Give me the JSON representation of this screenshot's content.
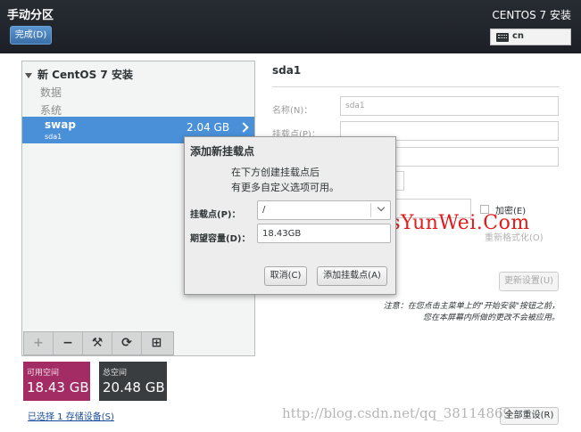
{
  "header": {
    "title": "手动分区",
    "done_label": "完成(D)",
    "product": "CENTOS 7 安装",
    "keyboard_layout": "cn"
  },
  "sidebar": {
    "group_label": "新 CentOS 7 安装",
    "categories": [
      "数据",
      "系统"
    ],
    "selected": {
      "name": "swap",
      "device": "sda1",
      "size": "2.04 GB"
    }
  },
  "toolbar": {
    "add": "+",
    "remove": "−",
    "configure": "⚒",
    "refresh": "⟳",
    "save_icon": "⊞"
  },
  "space": {
    "available_label": "可用空间",
    "available_value": "18.43 GB",
    "total_label": "总空间",
    "total_value": "20.48 GB",
    "storage_link": "已选择 1 存储设备(S)"
  },
  "details": {
    "device_title": "sda1",
    "name_label": "名称(N)：",
    "name_value": "sda1",
    "mount_label": "挂载点(P)：",
    "encrypt_label": "加密(E)",
    "reformat_label": "重新格式化(O)",
    "update_label": "更新设置(U)",
    "note_line1": "注意：在您点击主菜单上的\"开始安装\"按钮之前，",
    "note_line2": "您在本屏幕内所做的更改不会被应用。",
    "reset_label": "全部重设(R)"
  },
  "dialog": {
    "title": "添加新挂载点",
    "desc_line1": "在下方创建挂载点后",
    "desc_line2": "有更多自定义选项可用。",
    "mount_label": "挂载点(P)：",
    "mount_value": "/",
    "capacity_label": "期望容量(D)：",
    "capacity_value": "18.43GB",
    "cancel_label": "取消(C)",
    "add_label": "添加挂载点(A)"
  },
  "watermarks": {
    "site": "Www.OsYunWei.Com",
    "blog": "http://blog.csdn.net/qq_38114869"
  },
  "colors": {
    "header_bg": "#1f2329",
    "selection": "#4a90d9",
    "available_bg": "#a42c65",
    "total_bg": "#3a3d3f",
    "watermark_red": "#e21b1b"
  },
  "icons": [
    "keyboard-icon",
    "expand-triangle-icon",
    "chevron-right-icon",
    "plus-icon",
    "minus-icon",
    "configure-icon",
    "refresh-icon",
    "save-icon",
    "chevron-down-icon"
  ]
}
